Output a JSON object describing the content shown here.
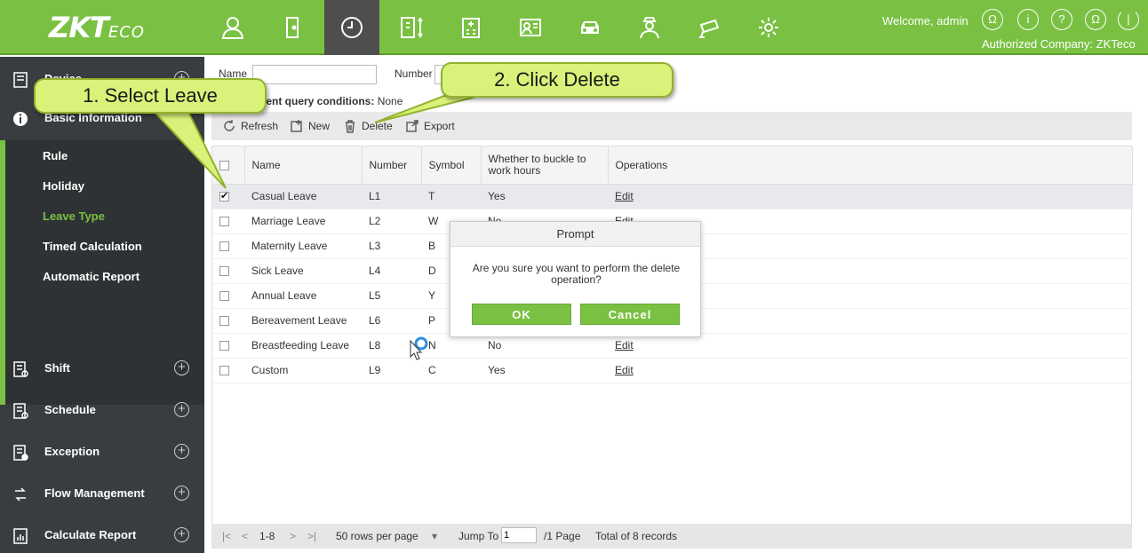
{
  "topbar": {
    "logo_main": "ZKT",
    "logo_tail": "ECO",
    "welcome": "Welcome, admin",
    "company": "Authorized Company: ZKTeco",
    "module_icons": [
      "person-icon",
      "door-icon",
      "clock-icon",
      "elevator-icon",
      "building-icon",
      "visitor-icon",
      "car-icon",
      "guard-icon",
      "camera-icon",
      "settings-icon"
    ],
    "right_icons": [
      "user-circle-icon",
      "info-icon",
      "help-icon",
      "account-icon",
      "power-icon"
    ]
  },
  "sidebar": {
    "device": "Device",
    "basic_info": "Basic Information",
    "items": [
      "Rule",
      "Holiday",
      "Leave Type",
      "Timed Calculation",
      "Automatic Report"
    ],
    "active_item": "Leave Type",
    "groups": [
      "Shift",
      "Schedule",
      "Exception",
      "Flow Management",
      "Calculate Report"
    ]
  },
  "filter": {
    "name_label": "Name",
    "number_label": "Number",
    "conditions_label": "Current query conditions:",
    "conditions_value": "None"
  },
  "toolbar": {
    "refresh": "Refresh",
    "new": "New",
    "delete": "Delete",
    "export": "Export"
  },
  "table": {
    "headers": [
      "Name",
      "Number",
      "Symbol",
      "Whether to buckle to work hours",
      "Operations"
    ],
    "rows": [
      {
        "name": "Casual Leave",
        "number": "L1",
        "symbol": "T",
        "buckle": "Yes",
        "op": "Edit",
        "checked": true
      },
      {
        "name": "Marriage Leave",
        "number": "L2",
        "symbol": "W",
        "buckle": "No",
        "op": "Edit",
        "checked": false
      },
      {
        "name": "Maternity Leave",
        "number": "L3",
        "symbol": "B",
        "buckle": "",
        "op": "",
        "checked": false
      },
      {
        "name": "Sick Leave",
        "number": "L4",
        "symbol": "D",
        "buckle": "",
        "op": "",
        "checked": false
      },
      {
        "name": "Annual Leave",
        "number": "L5",
        "symbol": "Y",
        "buckle": "",
        "op": "",
        "checked": false
      },
      {
        "name": "Bereavement Leave",
        "number": "L6",
        "symbol": "P",
        "buckle": "",
        "op": "",
        "checked": false
      },
      {
        "name": "Breastfeeding Leave",
        "number": "L8",
        "symbol": "N",
        "buckle": "No",
        "op": "Edit",
        "checked": false
      },
      {
        "name": "Custom",
        "number": "L9",
        "symbol": "C",
        "buckle": "Yes",
        "op": "Edit",
        "checked": false
      }
    ]
  },
  "pager": {
    "first": "|<",
    "prev": "<",
    "range": "1-8",
    "next": ">",
    "last": ">|",
    "rows_per_page": "50 rows per page",
    "jump_label": "Jump To",
    "jump_value": "1",
    "page_info": "/1 Page",
    "total": "Total of 8 records"
  },
  "dialog": {
    "title": "Prompt",
    "message": "Are you sure you want to perform the delete operation?",
    "ok": "OK",
    "cancel": "Cancel"
  },
  "callouts": {
    "step1": "1. Select Leave",
    "step2": "2. Click Delete"
  },
  "colors": {
    "brand_green": "#7ac143",
    "sidebar_dark": "#393d40",
    "callout_fill": "#d8f27a"
  }
}
